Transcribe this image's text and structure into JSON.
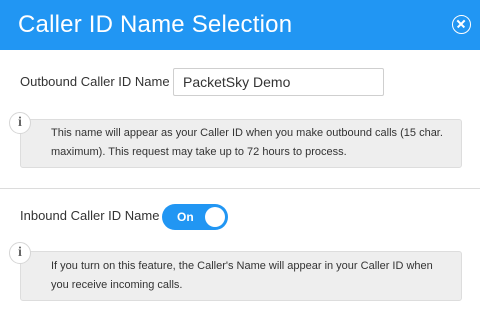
{
  "dialog": {
    "title": "Caller ID Name Selection",
    "close_icon": "close-circle-icon"
  },
  "outbound": {
    "label": "Outbound Caller ID Name",
    "value": "PacketSky Demo",
    "info_icon": "info-icon",
    "info_text": "This name will appear as your Caller ID when you make outbound calls (15 char. maximum). This request may take up to 72 hours to process."
  },
  "inbound": {
    "label": "Inbound Caller ID Name",
    "toggle_text": "On",
    "toggle_on": true,
    "info_icon": "info-icon",
    "info_text": "If you turn on this feature, the Caller's Name will appear in your Caller ID when you receive incoming calls."
  },
  "colors": {
    "header": "#2196f3",
    "toggle": "#2196f3",
    "info_box": "#eeeeee"
  }
}
